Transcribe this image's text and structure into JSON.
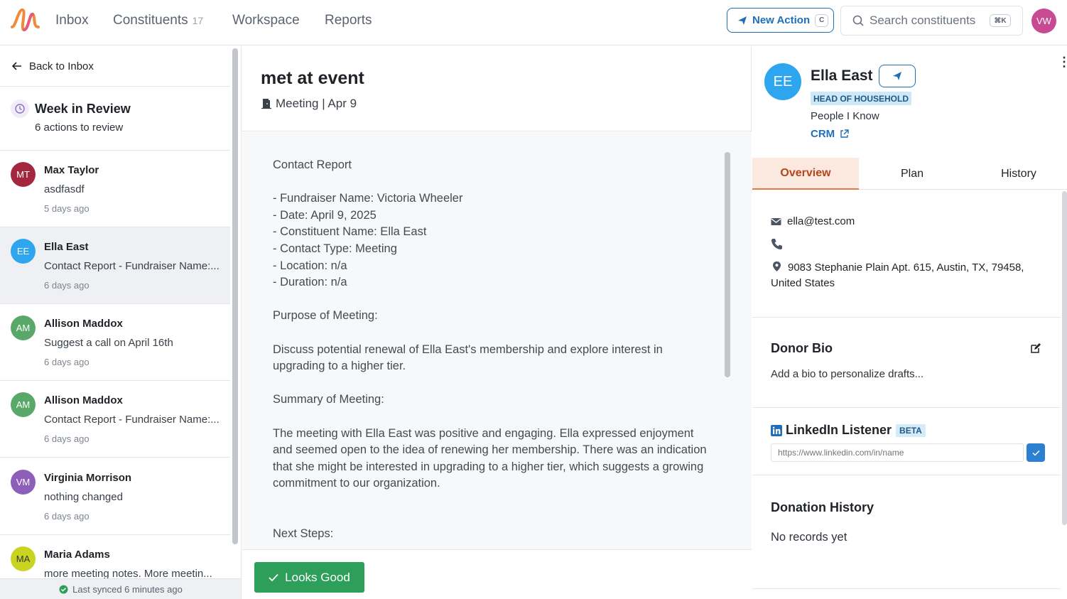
{
  "nav": {
    "items": [
      "Inbox",
      "Constituents",
      "Workspace",
      "Reports"
    ],
    "constituents_count": "17",
    "new_action_label": "New Action",
    "new_action_shortcut": "C",
    "search_placeholder": "Search constituents",
    "search_shortcut": "⌘K",
    "user_initials": "VW"
  },
  "sidebar": {
    "back_label": "Back to Inbox",
    "review_title": "Week in Review",
    "review_subtitle": "6 actions to review",
    "items": [
      {
        "initials": "MT",
        "name": "Max Taylor",
        "preview": "asdfasdf",
        "time": "5 days ago",
        "color": "#a3283f"
      },
      {
        "initials": "EE",
        "name": "Ella East",
        "preview": "Contact Report - Fundraiser Name:...",
        "time": "6 days ago",
        "color": "#2ea6ef"
      },
      {
        "initials": "AM",
        "name": "Allison Maddox",
        "preview": "Suggest a call on April 16th",
        "time": "6 days ago",
        "color": "#5aa869"
      },
      {
        "initials": "AM",
        "name": "Allison Maddox",
        "preview": "Contact Report - Fundraiser Name:...",
        "time": "6 days ago",
        "color": "#5aa869"
      },
      {
        "initials": "VM",
        "name": "Virginia Morrison",
        "preview": "nothing changed",
        "time": "6 days ago",
        "color": "#8e5fb8"
      },
      {
        "initials": "MA",
        "name": "Maria Adams",
        "preview": "more meeting notes. More meetin...",
        "time": "",
        "color": "#c8d41f"
      }
    ],
    "synced_label": "Last synced 6 minutes ago"
  },
  "action": {
    "title": "met at event",
    "subtitle": "Meeting | Apr 9",
    "body": [
      "Contact Report",
      "",
      "- Fundraiser Name: Victoria Wheeler",
      "- Date: April 9, 2025",
      "- Constituent Name: Ella East",
      "- Contact Type: Meeting",
      "- Location: n/a",
      "- Duration: n/a",
      "",
      "Purpose of Meeting:",
      "",
      "Discuss potential renewal of Ella East's membership and explore interest in upgrading to a higher tier.",
      "",
      "Summary of Meeting:",
      "",
      "The meeting with Ella East was positive and engaging. Ella expressed enjoyment and seemed open to the idea of renewing her membership. There was an indication that she might be interested in upgrading to a higher tier, which suggests a growing commitment to our organization.",
      "",
      "",
      "Next Steps:"
    ],
    "looks_good_label": "Looks Good"
  },
  "profile": {
    "initials": "EE",
    "name": "Ella East",
    "badge": "HEAD OF HOUSEHOLD",
    "list": "People I Know",
    "crm_label": "CRM",
    "tabs": [
      "Overview",
      "Plan",
      "History"
    ],
    "email": "ella@test.com",
    "phone": "",
    "address": "9083 Stephanie Plain Apt. 615, Austin, TX, 79458, United States",
    "donor_bio_title": "Donor Bio",
    "donor_bio_placeholder": "Add a bio to personalize drafts...",
    "linkedin_title": "LinkedIn Listener",
    "linkedin_badge": "BETA",
    "linkedin_placeholder": "https://www.linkedin.com/in/name",
    "donation_title": "Donation History",
    "donation_empty": "No records yet"
  },
  "colors": {
    "accent_blue": "#1e6fb8",
    "success_green": "#2e9e5b",
    "active_tab_bg": "#fbe9df",
    "active_tab_text": "#b3461c"
  }
}
